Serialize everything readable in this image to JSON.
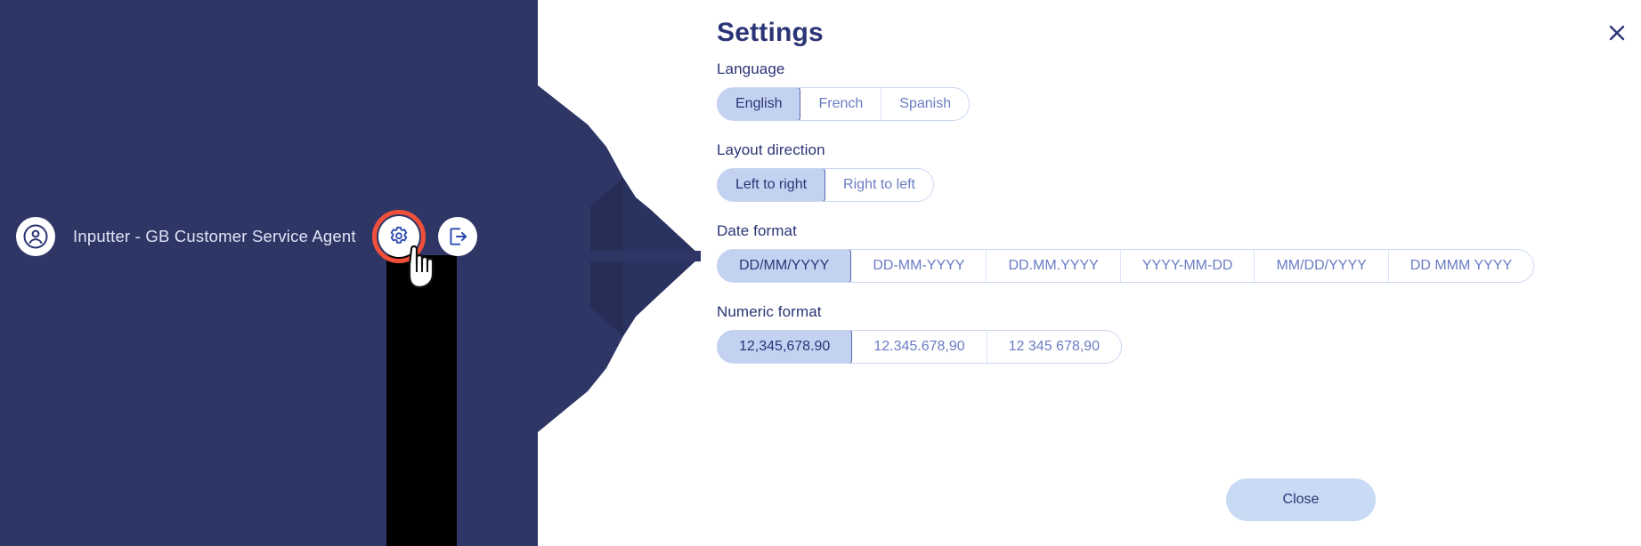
{
  "colors": {
    "navy": "#2e3666",
    "navy_dark": "#272f5c",
    "accent_red": "#f0503a",
    "title": "#2b3475",
    "seg_selected_bg": "#c4d2f2",
    "seg_border": "#c9d6f2",
    "seg_text": "#6a7cc4",
    "close_btn_bg": "#c9daf5",
    "black_bar": "#000000"
  },
  "user_bar": {
    "avatar_icon": "user-circle-icon",
    "name": "Inputter - GB Customer Service Agent",
    "settings_icon": "gear-icon",
    "logout_icon": "logout-icon",
    "cursor_icon": "hand-pointer-cursor"
  },
  "settings": {
    "title": "Settings",
    "close_icon": "close-x-icon",
    "close_button_label": "Close",
    "groups": [
      {
        "label": "Language",
        "options": [
          "English",
          "French",
          "Spanish"
        ],
        "selected_index": 0
      },
      {
        "label": "Layout direction",
        "options": [
          "Left to right",
          "Right to left"
        ],
        "selected_index": 0
      },
      {
        "label": "Date format",
        "options": [
          "DD/MM/YYYY",
          "DD-MM-YYYY",
          "DD.MM.YYYY",
          "YYYY-MM-DD",
          "MM/DD/YYYY",
          "DD MMM YYYY"
        ],
        "selected_index": 0
      },
      {
        "label": "Numeric format",
        "options": [
          "12,345,678.90",
          "12.345.678,90",
          "12 345 678,90"
        ],
        "selected_index": 0
      }
    ]
  }
}
